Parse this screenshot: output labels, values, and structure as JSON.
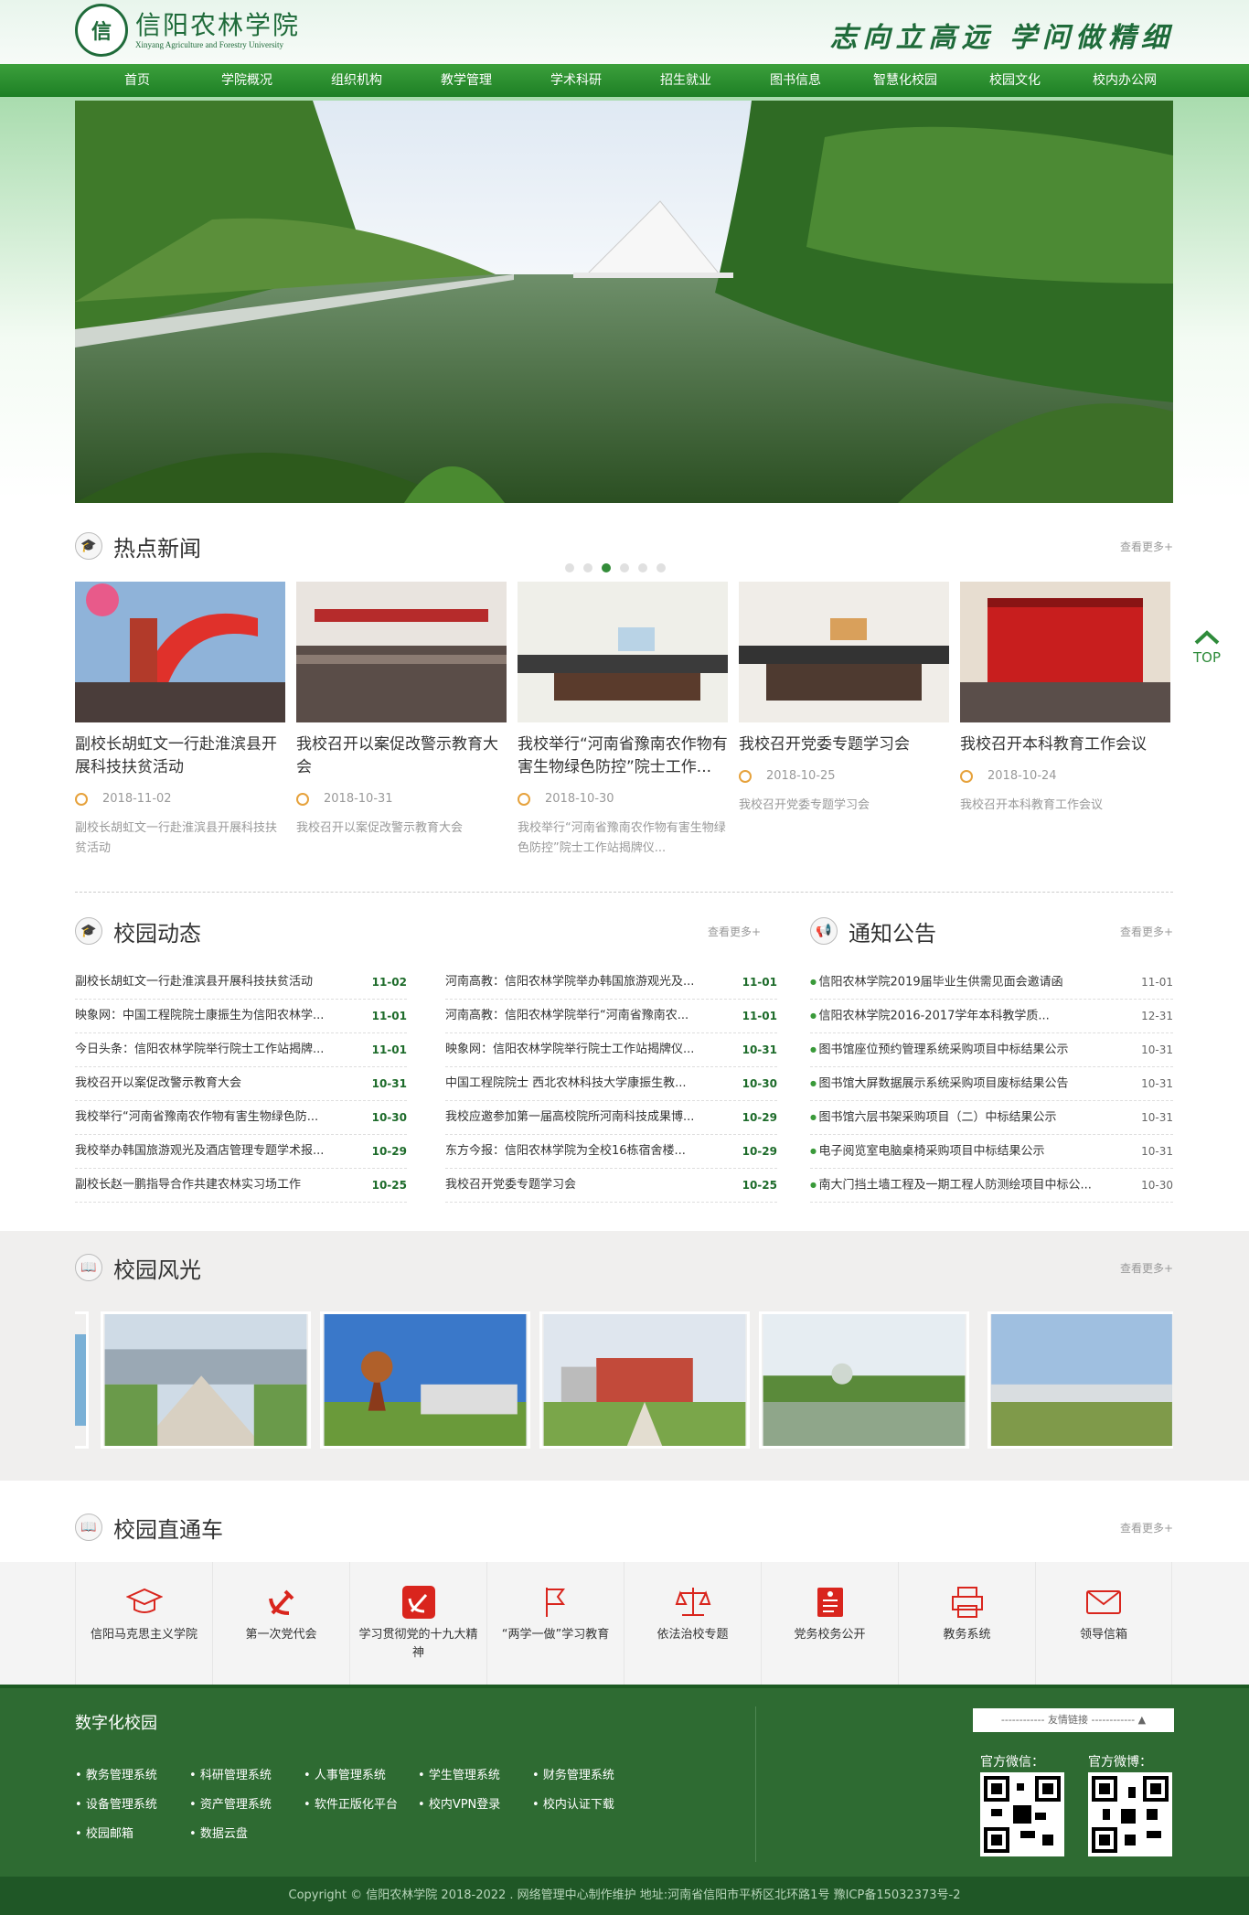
{
  "header": {
    "logo_cn": "信阳农林学院",
    "logo_en": "Xinyang Agriculture and Forestry University",
    "seal_text": "信",
    "motto": "志向立高远  学问做精细"
  },
  "nav": [
    "首页",
    "学院概况",
    "组织机构",
    "教学管理",
    "学术科研",
    "招生就业",
    "图书信息",
    "智慧化校园",
    "校园文化",
    "校内办公网"
  ],
  "banner": {
    "slides": 6,
    "active_index": 2
  },
  "hot_news": {
    "title": "热点新闻",
    "more": "查看更多+",
    "items": [
      {
        "title": "副校长胡虹文一行赴淮滨县开展科技扶贫活动",
        "date": "2018-11-02",
        "desc": "副校长胡虹文一行赴淮滨县开展科技扶贫活动"
      },
      {
        "title": "我校召开以案促改警示教育大会",
        "date": "2018-10-31",
        "desc": "我校召开以案促改警示教育大会"
      },
      {
        "title": "我校举行“河南省豫南农作物有害生物绿色防控”院士工作...",
        "date": "2018-10-30",
        "desc": "我校举行“河南省豫南农作物有害生物绿色防控”院士工作站揭牌仪..."
      },
      {
        "title": "我校召开党委专题学习会",
        "date": "2018-10-25",
        "desc": "我校召开党委专题学习会"
      },
      {
        "title": "我校召开本科教育工作会议",
        "date": "2018-10-24",
        "desc": "我校召开本科教育工作会议"
      }
    ]
  },
  "campus_news": {
    "title": "校园动态",
    "more": "查看更多+",
    "col1": [
      {
        "t": "副校长胡虹文一行赴淮滨县开展科技扶贫活动",
        "d": "11-02"
      },
      {
        "t": "映象网：中国工程院院士康振生为信阳农林学...",
        "d": "11-01"
      },
      {
        "t": "今日头条：信阳农林学院举行院士工作站揭牌...",
        "d": "11-01"
      },
      {
        "t": "我校召开以案促改警示教育大会",
        "d": "10-31"
      },
      {
        "t": "我校举行“河南省豫南农作物有害生物绿色防...",
        "d": "10-30"
      },
      {
        "t": "我校举办韩国旅游观光及酒店管理专题学术报...",
        "d": "10-29"
      },
      {
        "t": "副校长赵一鹏指导合作共建农林实习场工作",
        "d": "10-25"
      }
    ],
    "col2": [
      {
        "t": "河南高教：信阳农林学院举办韩国旅游观光及...",
        "d": "11-01"
      },
      {
        "t": "河南高教：信阳农林学院举行“河南省豫南农...",
        "d": "11-01"
      },
      {
        "t": "映象网：信阳农林学院举行院士工作站揭牌仪...",
        "d": "10-31"
      },
      {
        "t": "中国工程院院士 西北农林科技大学康振生教...",
        "d": "10-30"
      },
      {
        "t": "我校应邀参加第一届高校院所河南科技成果博...",
        "d": "10-29"
      },
      {
        "t": "东方今报：信阳农林学院为全校16栋宿舍楼...",
        "d": "10-29"
      },
      {
        "t": "我校召开党委专题学习会",
        "d": "10-25"
      }
    ]
  },
  "notices": {
    "title": "通知公告",
    "more": "查看更多+",
    "items": [
      {
        "t": "信阳农林学院2019届毕业生供需见面会邀请函",
        "d": "11-01"
      },
      {
        "t": "信阳农林学院2016-2017学年本科教学质...",
        "d": "12-31"
      },
      {
        "t": "图书馆座位预约管理系统采购项目中标结果公示",
        "d": "10-31"
      },
      {
        "t": "图书馆大屏数据展示系统采购项目废标结果公告",
        "d": "10-31"
      },
      {
        "t": "图书馆六层书架采购项目（二）中标结果公示",
        "d": "10-31"
      },
      {
        "t": "电子阅览室电脑桌椅采购项目中标结果公示",
        "d": "10-31"
      },
      {
        "t": "南大门挡土墙工程及一期工程人防测绘项目中标公...",
        "d": "10-30"
      }
    ]
  },
  "scenery": {
    "title": "校园风光",
    "more": "查看更多+"
  },
  "portal": {
    "title": "校园直通车",
    "more": "查看更多+",
    "items": [
      {
        "label": "信阳马克思主义学院",
        "icon": "graduation-cap-icon"
      },
      {
        "label": "第一次党代会",
        "icon": "hammer-sickle-icon"
      },
      {
        "label": "学习贯彻党的十九大精神",
        "icon": "party-flag-icon"
      },
      {
        "label": "“两学一做”学习教育",
        "icon": "flag-icon"
      },
      {
        "label": "依法治校专题",
        "icon": "scales-icon"
      },
      {
        "label": "党务校务公开",
        "icon": "document-icon"
      },
      {
        "label": "教务系统",
        "icon": "printer-icon"
      },
      {
        "label": "领导信箱",
        "icon": "mail-icon"
      }
    ]
  },
  "footer": {
    "title": "数字化校园",
    "links": [
      "教务管理系统",
      "科研管理系统",
      "人事管理系统",
      "学生管理系统",
      "财务管理系统",
      "设备管理系统",
      "资产管理系统",
      "软件正版化平台",
      "校内VPN登录",
      "校内认证下载",
      "校园邮箱",
      "数据云盘"
    ],
    "friend_links": "------------ 友情链接 ------------",
    "wechat": "官方微信：",
    "weibo": "官方微博：",
    "copyright": "Copyright © 信阳农林学院 2018-2022 . 网络管理中心制作维护  地址:河南省信阳市平桥区北环路1号    豫ICP备15032373号-2"
  },
  "top_button": "TOP",
  "colors": {
    "brand_green": "#1d7f24",
    "accent_orange": "#e6a23c",
    "portal_red": "#d9251d"
  }
}
